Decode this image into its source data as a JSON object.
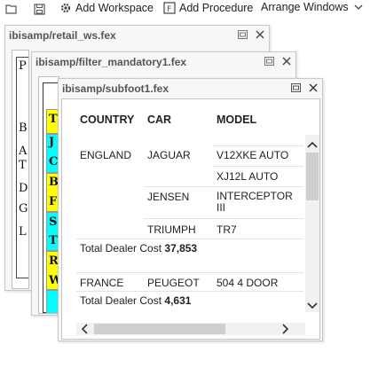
{
  "toolbar": {
    "add_workspace": "Add Workspace",
    "add_procedure": "Add Procedure",
    "arrange_windows": "Arrange Windows"
  },
  "windows": {
    "back": {
      "title": "ibisamp/retail_ws.fex",
      "side_letters": [
        "P",
        "B",
        "A",
        "T",
        "D",
        "G",
        "L"
      ]
    },
    "middle": {
      "title": "ibisamp/filter_mandatory1.fex",
      "side_letters": [
        "T",
        "J",
        "C",
        "B",
        "F",
        "S",
        "T",
        "R",
        "W"
      ]
    },
    "front": {
      "title": "ibisamp/subfoot1.fex",
      "headers": {
        "country": "COUNTRY",
        "car": "CAR",
        "model": "MODEL"
      },
      "rows": [
        {
          "country": "ENGLAND",
          "car": "JAGUAR",
          "model": "V12XKE AUTO"
        },
        {
          "country": "",
          "car": "",
          "model": "XJ12L AUTO"
        },
        {
          "country": "",
          "car": "JENSEN",
          "model": "INTERCEPTOR III"
        },
        {
          "country": "",
          "car": "TRIUMPH",
          "model": "TR7"
        }
      ],
      "subfoot1": {
        "label": "Total Dealer Cost",
        "value": "37,853"
      },
      "row_france": {
        "country": "FRANCE",
        "car": "PEUGEOT",
        "model": "504 4 DOOR"
      },
      "subfoot2": {
        "label": "Total Dealer Cost",
        "value": "4,631"
      }
    }
  },
  "colors": {
    "yellow": "#ffff00",
    "cyan": "#00ffff"
  }
}
